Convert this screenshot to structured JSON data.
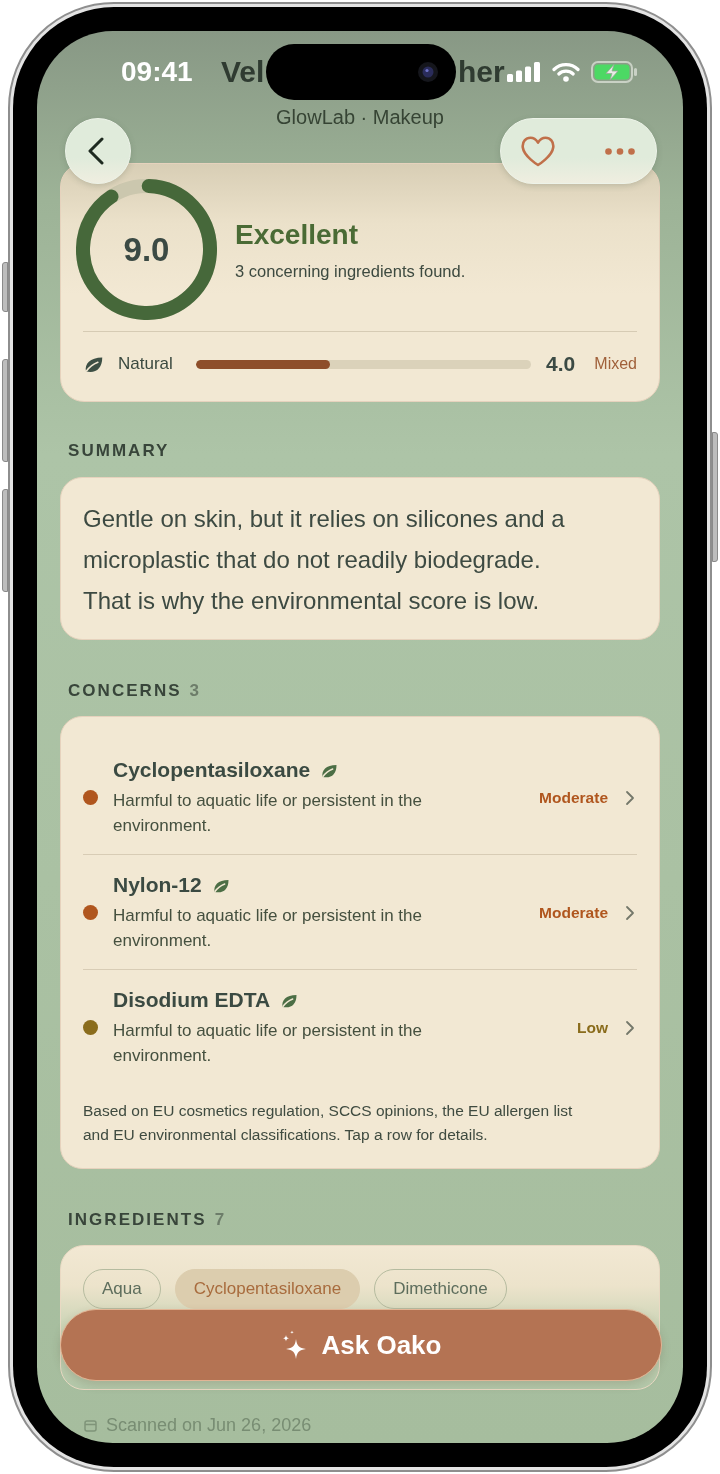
{
  "status_bar": {
    "time": "09:41"
  },
  "header": {
    "title_start": "Vel",
    "title_end": "her",
    "subtitle": "GlowLab · Makeup",
    "favorited": false
  },
  "score": {
    "value": "9.0",
    "level": 0.9,
    "rating": "Excellent",
    "note": "3 concerning ingredients found.",
    "natural": {
      "label": "Natural",
      "level": 0.4,
      "value": "4.0",
      "rating": "Mixed"
    }
  },
  "summary": {
    "heading": "SUMMARY",
    "text": "Gentle on skin, but it relies on silicones and a microplastic that do not readily biodegrade. That is why the environmental score is low."
  },
  "concerns": {
    "heading": "CONCERNS",
    "count": "3",
    "items": [
      {
        "name": "Cyclopentasiloxane",
        "description": "Harmful to aquatic life or persistent in the environment.",
        "severity": "Moderate",
        "color": "#b0561e"
      },
      {
        "name": "Nylon-12",
        "description": "Harmful to aquatic life or persistent in the environment.",
        "severity": "Moderate",
        "color": "#b0561e"
      },
      {
        "name": "Disodium EDTA",
        "description": "Harmful to aquatic life or persistent in the environment.",
        "severity": "Low",
        "color": "#8a6c1c"
      }
    ],
    "note": "Based on EU cosmetics regulation, SCCS opinions, the EU allergen list and EU environmental classifications. Tap a row for details."
  },
  "ingredients": {
    "heading": "INGREDIENTS",
    "count": "7",
    "items": [
      {
        "name": "Aqua",
        "flagged": false
      },
      {
        "name": "Cyclopentasiloxane",
        "flagged": true
      },
      {
        "name": "Dimethicone",
        "flagged": false
      }
    ]
  },
  "ask_button": {
    "label": "Ask Oako"
  },
  "footer": {
    "scanned": "Scanned on Jun 26, 2026"
  }
}
